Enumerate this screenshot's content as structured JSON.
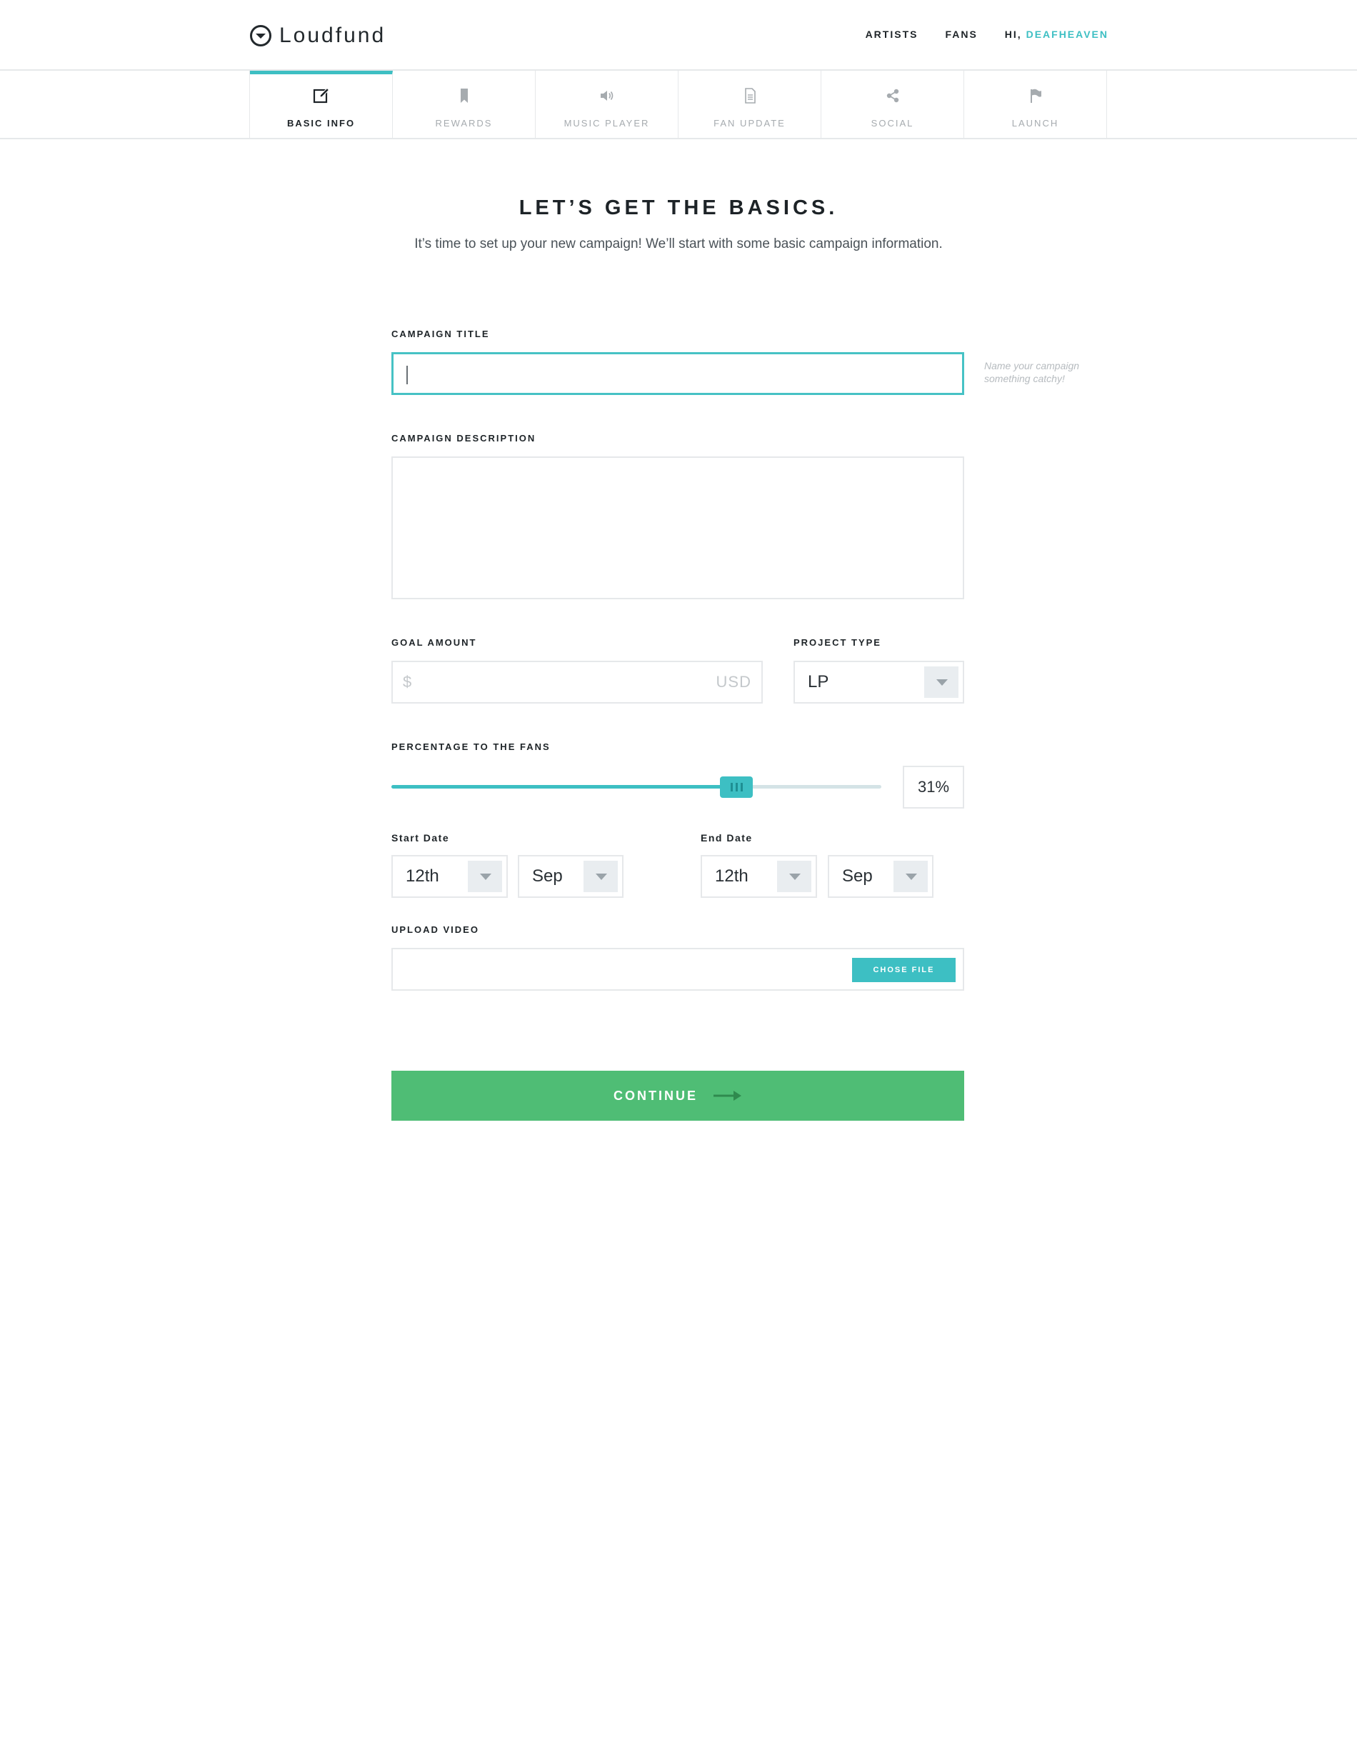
{
  "header": {
    "brand": "Loudfund",
    "nav": [
      "ARTISTS",
      "FANS"
    ],
    "greeting": "HI,",
    "username": "DEAFHEAVEN"
  },
  "steps": [
    {
      "label": "BASIC INFO",
      "icon": "edit-icon",
      "active": true
    },
    {
      "label": "REWARDS",
      "icon": "bookmark-icon",
      "active": false
    },
    {
      "label": "MUSIC PLAYER",
      "icon": "speaker-icon",
      "active": false
    },
    {
      "label": "FAN UPDATE",
      "icon": "document-icon",
      "active": false
    },
    {
      "label": "SOCIAL",
      "icon": "share-icon",
      "active": false
    },
    {
      "label": "LAUNCH",
      "icon": "flag-icon",
      "active": false
    }
  ],
  "intro": {
    "title": "LET’S GET THE BASICS.",
    "subtitle": "It’s time to set up your new campaign! We’ll start with some basic campaign information."
  },
  "form": {
    "campaign_title": {
      "label": "CAMPAIGN TITLE",
      "value": "",
      "hint": "Name your campaign something catchy!"
    },
    "campaign_description": {
      "label": "CAMPAIGN DESCRIPTION",
      "value": ""
    },
    "goal_amount": {
      "label": "GOAL AMOUNT",
      "prefix": "$",
      "suffix": "USD",
      "value": ""
    },
    "project_type": {
      "label": "PROJECT TYPE",
      "value": "LP"
    },
    "percentage": {
      "label": "PERCENTAGE TO THE FANS",
      "value": 31,
      "display": "31%"
    },
    "start_date": {
      "label": "Start Date",
      "day": "12th",
      "month": "Sep"
    },
    "end_date": {
      "label": "End Date",
      "day": "12th",
      "month": "Sep"
    },
    "upload_video": {
      "label": "UPLOAD VIDEO",
      "button": "CHOSE FILE"
    }
  },
  "continue_label": "CONTINUE",
  "colors": {
    "accent": "#3dbfc3",
    "continue": "#4fbd75",
    "border": "#e6e8ea"
  }
}
